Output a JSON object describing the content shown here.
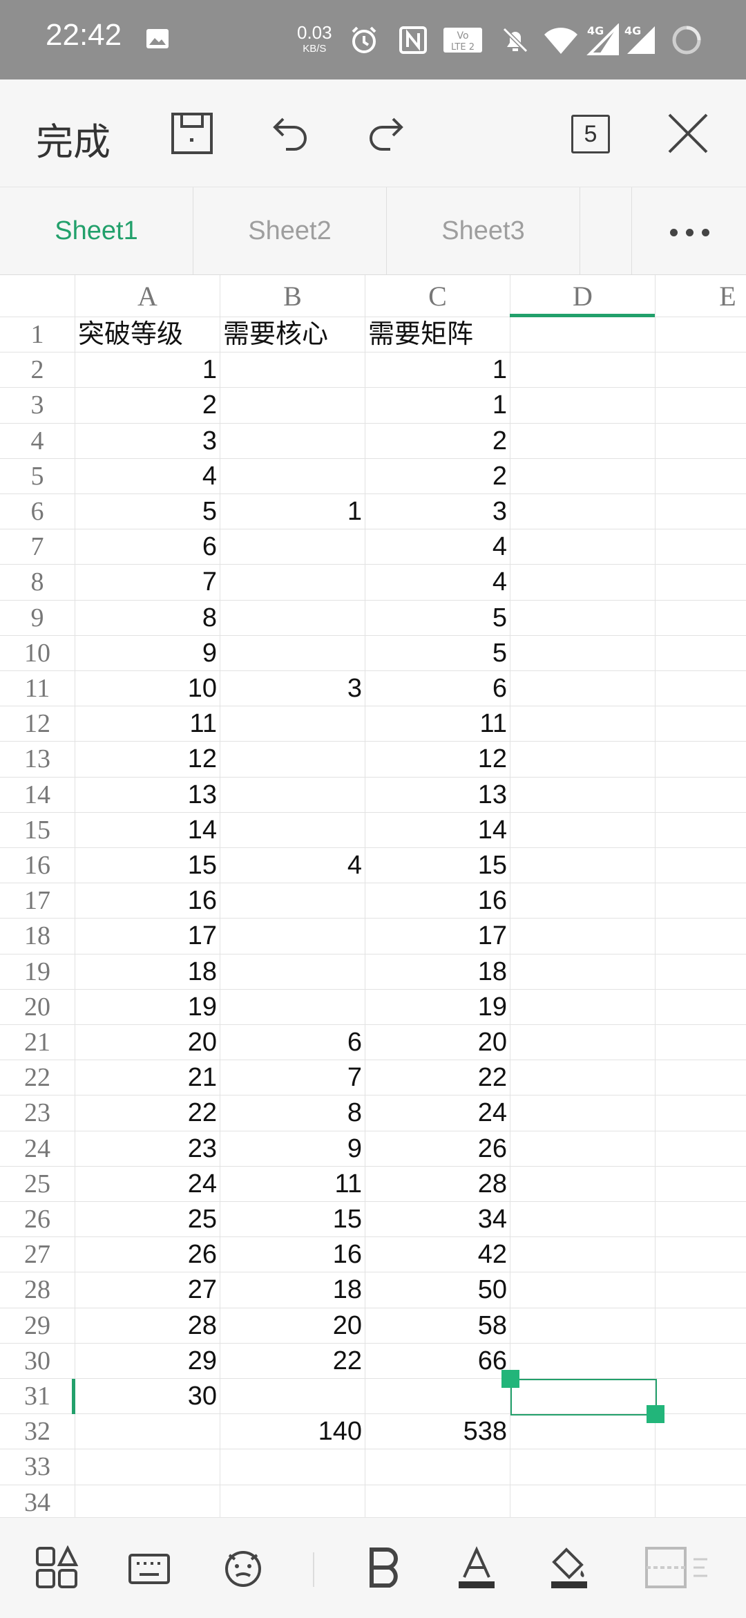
{
  "status_bar": {
    "time": "22:42",
    "speed_value": "0.03",
    "speed_unit": "KB/S",
    "icons": [
      "image-icon",
      "alarm-icon",
      "nfc-icon",
      "volte-icon",
      "mute-icon",
      "wifi-icon",
      "signal-4g-icon",
      "signal-4g-icon",
      "loading-icon"
    ]
  },
  "toolbar": {
    "done_label": "完成",
    "window_count": "5",
    "icons": [
      "save-icon",
      "undo-icon",
      "redo-icon",
      "close-icon"
    ]
  },
  "sheet_tabs": [
    "Sheet1",
    "Sheet2",
    "Sheet3"
  ],
  "active_sheet": "Sheet1",
  "grid": {
    "column_headers": [
      "A",
      "B",
      "C",
      "D",
      "E"
    ],
    "selected_column": "D",
    "selected_row": "31",
    "selected_cell": "D31",
    "rows": [
      {
        "n": "1",
        "a": "突破等级",
        "b": "需要核心",
        "c": "需要矩阵"
      },
      {
        "n": "2",
        "a": "1",
        "b": "",
        "c": "1"
      },
      {
        "n": "3",
        "a": "2",
        "b": "",
        "c": "1"
      },
      {
        "n": "4",
        "a": "3",
        "b": "",
        "c": "2"
      },
      {
        "n": "5",
        "a": "4",
        "b": "",
        "c": "2"
      },
      {
        "n": "6",
        "a": "5",
        "b": "1",
        "c": "3"
      },
      {
        "n": "7",
        "a": "6",
        "b": "",
        "c": "4"
      },
      {
        "n": "8",
        "a": "7",
        "b": "",
        "c": "4"
      },
      {
        "n": "9",
        "a": "8",
        "b": "",
        "c": "5"
      },
      {
        "n": "10",
        "a": "9",
        "b": "",
        "c": "5"
      },
      {
        "n": "11",
        "a": "10",
        "b": "3",
        "c": "6"
      },
      {
        "n": "12",
        "a": "11",
        "b": "",
        "c": "11"
      },
      {
        "n": "13",
        "a": "12",
        "b": "",
        "c": "12"
      },
      {
        "n": "14",
        "a": "13",
        "b": "",
        "c": "13"
      },
      {
        "n": "15",
        "a": "14",
        "b": "",
        "c": "14"
      },
      {
        "n": "16",
        "a": "15",
        "b": "4",
        "c": "15"
      },
      {
        "n": "17",
        "a": "16",
        "b": "",
        "c": "16"
      },
      {
        "n": "18",
        "a": "17",
        "b": "",
        "c": "17"
      },
      {
        "n": "19",
        "a": "18",
        "b": "",
        "c": "18"
      },
      {
        "n": "20",
        "a": "19",
        "b": "",
        "c": "19"
      },
      {
        "n": "21",
        "a": "20",
        "b": "6",
        "c": "20"
      },
      {
        "n": "22",
        "a": "21",
        "b": "7",
        "c": "22"
      },
      {
        "n": "23",
        "a": "22",
        "b": "8",
        "c": "24"
      },
      {
        "n": "24",
        "a": "23",
        "b": "9",
        "c": "26"
      },
      {
        "n": "25",
        "a": "24",
        "b": "11",
        "c": "28"
      },
      {
        "n": "26",
        "a": "25",
        "b": "15",
        "c": "34"
      },
      {
        "n": "27",
        "a": "26",
        "b": "16",
        "c": "42"
      },
      {
        "n": "28",
        "a": "27",
        "b": "18",
        "c": "50"
      },
      {
        "n": "29",
        "a": "28",
        "b": "20",
        "c": "58"
      },
      {
        "n": "30",
        "a": "29",
        "b": "22",
        "c": "66"
      },
      {
        "n": "31",
        "a": "30",
        "b": "",
        "c": ""
      },
      {
        "n": "32",
        "a": "",
        "b": "140",
        "c": "538"
      },
      {
        "n": "33",
        "a": "",
        "b": "",
        "c": ""
      },
      {
        "n": "34",
        "a": "",
        "b": "",
        "c": ""
      }
    ]
  },
  "bottom_toolbar": {
    "icons": [
      "apps-icon",
      "keyboard-icon",
      "bot-icon",
      "bold-icon",
      "font-color-icon",
      "fill-color-icon",
      "border-icon"
    ],
    "accent": "#22a06b"
  }
}
